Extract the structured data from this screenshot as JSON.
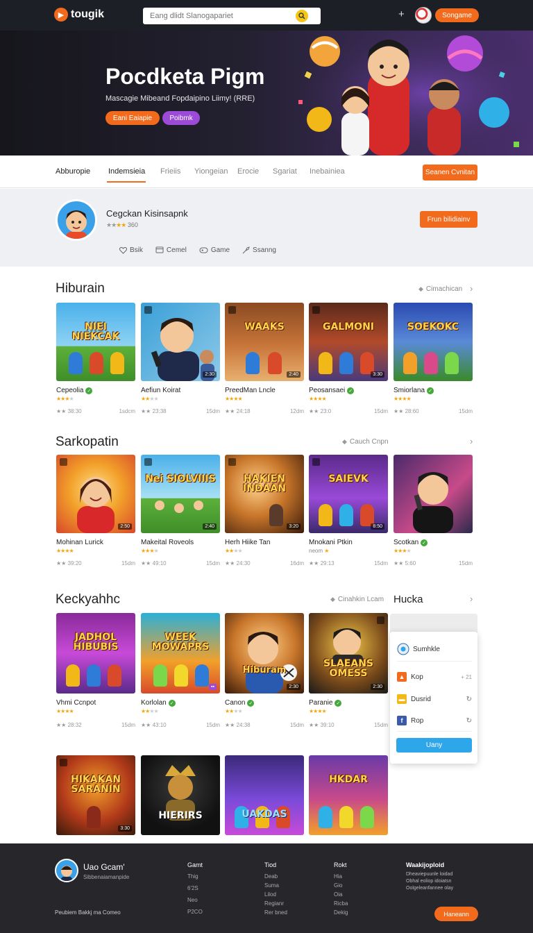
{
  "header": {
    "logo_mark": "▶",
    "logo_text": "tougik",
    "search_placeholder": "Eang dlidt Slanogapariet",
    "search_icon": "search-icon",
    "plus_icon": "+",
    "signin_label": "Songame"
  },
  "hero": {
    "title": "Pocdketa Pigm",
    "subtitle": "Mascagie Mibeand Fopdaipino Liimy! (RRE)",
    "primary_btn": "Eani Eaiapie",
    "secondary_btn": "Poibmk"
  },
  "tabs": {
    "items": [
      {
        "label": "Abburopie"
      },
      {
        "label": "Indemsieia"
      },
      {
        "label": "Frieiis"
      },
      {
        "label": "Yiongeian"
      },
      {
        "label": "Erocie"
      },
      {
        "label": "Sgariat"
      },
      {
        "label": "Inebainiea"
      }
    ],
    "active_index": 1,
    "action_btn": "Seanen Cvnitan"
  },
  "profile": {
    "name": "Cegckan Kisinsapnk",
    "rating_stars": 4,
    "rating_count": "360",
    "follow_btn": "Frun bilidiainv",
    "actions": [
      {
        "icon": "heart-icon",
        "label": "Bsik"
      },
      {
        "icon": "comment-icon",
        "label": "Cemel"
      },
      {
        "icon": "game-icon",
        "label": "Game"
      },
      {
        "icon": "share-icon",
        "label": "Ssanng"
      }
    ]
  },
  "sections": [
    {
      "title": "Hiburain",
      "link": "Cimachican",
      "cards": [
        {
          "art_title": "NIEI NIEKCAK",
          "name": "Cepeolia",
          "verified": true,
          "stars": 3,
          "count": "38:30",
          "size": "1sdcm",
          "badge": ""
        },
        {
          "art_title": "",
          "name": "Aefiun Koirat",
          "verified": false,
          "stars": 2,
          "count": "23:38",
          "size": "15dm",
          "badge": "2:30"
        },
        {
          "art_title": "WAAKS",
          "name": "PreedMan Lncle",
          "verified": false,
          "stars": 4,
          "count": "24:18",
          "size": "12dm",
          "badge": "2:40"
        },
        {
          "art_title": "GALMONI",
          "name": "Peosansaei",
          "verified": true,
          "stars": 4,
          "count": "23:0",
          "size": "15dm",
          "badge": "3:30"
        },
        {
          "art_title": "SOEKOKC",
          "name": "Smiorlana",
          "verified": true,
          "stars": 4,
          "count": "28:60",
          "size": "15dm",
          "badge": ""
        }
      ]
    },
    {
      "title": "Sarkopatin",
      "link": "Cauch Cnpn",
      "cards": [
        {
          "art_title": "",
          "name": "Mohinan Lurick",
          "verified": false,
          "stars": 4,
          "count": "39:20",
          "size": "15dm",
          "badge": "2:50"
        },
        {
          "art_title": "Nei SIOLVIIIS",
          "name": "Makeital Roveols",
          "verified": false,
          "stars": 3,
          "count": "49:10",
          "size": "15dm",
          "badge": "2:40"
        },
        {
          "art_title": "HAKIEN INDAAN",
          "name": "Herh Hiike Tan",
          "verified": false,
          "stars": 2,
          "count": "24:30",
          "size": "16dm",
          "badge": "3:20"
        },
        {
          "art_title": "SAIEVK",
          "name": "Mnokani Ptkin",
          "verified": false,
          "stars": 1,
          "count": "29:13",
          "size": "15dm",
          "badge": "8:50",
          "sub": "neom"
        },
        {
          "art_title": "",
          "name": "Scotkan",
          "verified": true,
          "stars": 3,
          "count": "5:60",
          "size": "15dm",
          "badge": ""
        }
      ]
    },
    {
      "title": "Keckyahhc",
      "link": "Cinahkin Lcam",
      "second_title": "Hucka",
      "cards": [
        {
          "art_title": "JADHOL HIBUBIS",
          "name": "Vhmi Ccnpot",
          "verified": false,
          "stars": 4,
          "count": "28:32",
          "size": "15dm",
          "badge": ""
        },
        {
          "art_title": "WEEK MOWAPRS",
          "name": "Korlolan",
          "verified": true,
          "stars": 2,
          "count": "43:10",
          "size": "15dm",
          "badge": ""
        },
        {
          "art_title": "Hiburam",
          "name": "Canon",
          "verified": true,
          "stars": 2,
          "count": "24:38",
          "size": "15dm",
          "badge": "2:30"
        },
        {
          "art_title": "SLAEANS OMESS",
          "name": "Paranie",
          "verified": true,
          "stars": 4,
          "count": "39:10",
          "size": "15dm",
          "badge": "2:30"
        }
      ]
    },
    {
      "title": "",
      "cards": [
        {
          "art_title": "HIKAKAN SARANIN",
          "name": "",
          "badge": "3:30"
        },
        {
          "art_title": "HIERIRS",
          "name": "",
          "badge": ""
        },
        {
          "art_title": "UAKDAS",
          "name": "",
          "badge": ""
        },
        {
          "art_title": "HKDAR",
          "name": "",
          "badge": ""
        }
      ]
    }
  ],
  "share_popup": {
    "header": "Sumhkle",
    "items": [
      {
        "icon": "game-icon",
        "label": "Kop",
        "extra": "+ 21"
      },
      {
        "icon": "folder-icon",
        "label": "Dusrid",
        "extra": "↻"
      },
      {
        "icon": "facebook-icon",
        "label": "Rop",
        "extra": "↻"
      }
    ],
    "button": "Uany"
  },
  "footer": {
    "brand": "Uao Gcam'",
    "tagline": "Sibbenaiamanpide",
    "copyright": "Peubiem Bakkj ma Comeo",
    "columns": [
      {
        "heading": "Gamt",
        "items": [
          "Thig",
          "6'2S",
          "Neo",
          "P2CO"
        ]
      },
      {
        "heading": "Tiod",
        "items": [
          "Deab",
          "Suma",
          "Lilod",
          "Regianr",
          "Rer bned"
        ]
      },
      {
        "heading": "Rokt",
        "items": [
          "Hia",
          "Gio",
          "Oia",
          "Ricba",
          "Dekig"
        ]
      }
    ],
    "about_heading": "Waakijoploid",
    "about_text": [
      "Dheaviepuunle loidad",
      "Obhal eoliop idoiatsn",
      "Oolgeleanfannee olay"
    ],
    "button": "Haneann"
  },
  "colors": {
    "accent": "#f26b1d",
    "purple": "#9b4bd8",
    "dark": "#1d1f26",
    "footer": "#26262b",
    "verified": "#44a83a",
    "share": "#2ea6ea"
  }
}
